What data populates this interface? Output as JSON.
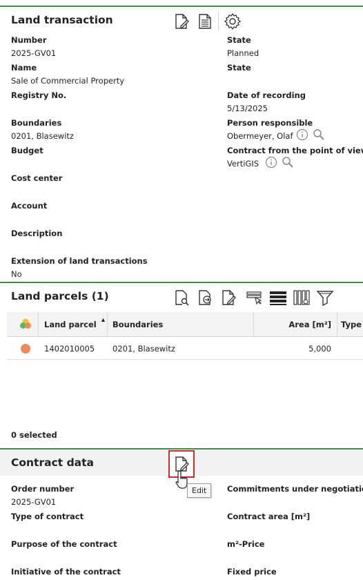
{
  "land_transaction": {
    "title": "Land transaction",
    "left_fields": [
      {
        "label": "Number",
        "value": "2025-GV01"
      },
      {
        "label": "Name",
        "value": "Sale of Commercial Property"
      },
      {
        "label": "Registry No.",
        "value": ""
      },
      {
        "label": "Boundaries",
        "value": "0201, Blasewitz"
      },
      {
        "label": "Budget",
        "value": ""
      },
      {
        "label": "Cost center",
        "value": ""
      },
      {
        "label": "Account",
        "value": ""
      },
      {
        "label": "Description",
        "value": ""
      },
      {
        "label": "Extension of land transactions",
        "value": "No"
      }
    ],
    "right_fields": [
      {
        "label": "State",
        "value": "Planned"
      },
      {
        "label": "State",
        "value": ""
      },
      {
        "label": "Date of recording",
        "value": "5/13/2025"
      },
      {
        "label": "Person responsible",
        "value": "Obermeyer, Olaf"
      },
      {
        "label": "Contract from the point of view of",
        "value": "VertiGIS"
      }
    ]
  },
  "land_parcels": {
    "title": "Land parcels (1)",
    "columns": [
      "Land parcel",
      "Boundaries",
      "Area [m²]",
      "Type c"
    ],
    "rows": [
      {
        "status_color": "#ef8a5a",
        "land_parcel": "1402010005",
        "boundaries": "0201, Blasewitz",
        "area": "5,000"
      }
    ],
    "selected_text": "0 selected"
  },
  "contract_data": {
    "title": "Contract data",
    "edit_tooltip": "Edit",
    "left_fields": [
      {
        "label": "Order number",
        "value": "2025-GV01"
      },
      {
        "label": "Type of contract",
        "value": ""
      },
      {
        "label": "Purpose of the contract",
        "value": ""
      },
      {
        "label": "Initiative of the contract",
        "value": ""
      }
    ],
    "right_fields": [
      {
        "label": "Commitments under negotiation",
        "value": ""
      },
      {
        "label": "Contract area [m²]",
        "value": ""
      },
      {
        "label": "m²-Price",
        "value": ""
      },
      {
        "label": "Fixed price",
        "value": ""
      }
    ]
  },
  "colors": {
    "accent_green": "#3a8f4b",
    "highlight_red": "#d42a2a",
    "status_orange": "#ef8a5a"
  }
}
